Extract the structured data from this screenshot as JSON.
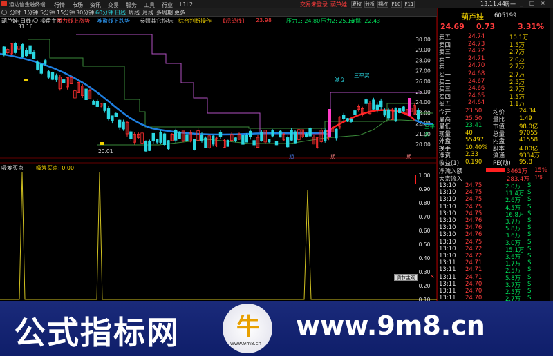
{
  "window": {
    "app_title": "通达信金融终端",
    "center_text_1": "交易未登录",
    "center_text_2": "葫芦娃",
    "time": "13:11:44",
    "weekday": "周一",
    "right_tabs": [
      "夏权",
      "分析",
      "期权",
      "F10",
      "F11"
    ],
    "window_controls": [
      "_",
      "□",
      "×"
    ]
  },
  "menu": {
    "items": [
      "行情",
      "市场",
      "资讯",
      "交易",
      "服务",
      "工具",
      "行业",
      "L1L2"
    ],
    "period_tabs": [
      "分时",
      "1分钟",
      "5分钟",
      "15分钟",
      "30分钟",
      "60分钟",
      "日线",
      "周线",
      "月线",
      "多周期",
      "更多"
    ]
  },
  "main_chart": {
    "stock_label": "葫芦娃(日线)",
    "indicator_label": "操盘主图",
    "legends": [
      {
        "text": "阻力线上涨势",
        "color": "#ff4040"
      },
      {
        "text": "唯盈线下跌势",
        "color": "#30a0ff"
      },
      {
        "text": "参照其它指标:",
        "color": "#cccccc"
      },
      {
        "text": "综合判断操作",
        "color": "#f0d000"
      },
      {
        "text": "【观望线】",
        "color": "#ff3c3c"
      },
      {
        "text": "23.98",
        "color": "#ff3c3c"
      },
      {
        "text": "压力1: 24.80",
        "color": "#00e05a"
      },
      {
        "text": "压力2: 25.13",
        "color": "#00e05a"
      },
      {
        "text": "支撑: 22.43",
        "color": "#00e05a"
      }
    ],
    "price_axis": [
      "30.00",
      "29.00",
      "28.00",
      "27.00",
      "26.00",
      "25.00",
      "24.00",
      "23.00",
      "22.00",
      "21.00",
      "20.00"
    ],
    "annotations": {
      "high_label": "31.16",
      "low_label": "20.01",
      "sell_label": "減仓",
      "three_buy_label": "三平买",
      "three_buy_right": "三平买",
      "bottom_marks": [
        "期",
        "期",
        "期"
      ]
    },
    "overlay_x_close": "×"
  },
  "sub_chart": {
    "title": "吸筹买点",
    "legend": "吸筹买点: 0.00",
    "axis": [
      "1.00",
      "0.90",
      "0.80",
      "0.70",
      "0.60",
      "0.50",
      "0.40",
      "0.30",
      "0.20",
      "0.10"
    ],
    "popup_label": "调节主观"
  },
  "quote_panel": {
    "stock_name": "葫芦娃",
    "stock_code": "605199",
    "price": "24.69",
    "change": "0.73",
    "change_pct": "3.31%",
    "asks": [
      {
        "label": "卖五",
        "price": "24.74",
        "volume": "10.1万"
      },
      {
        "label": "卖四",
        "price": "24.73",
        "volume": "1.5万"
      },
      {
        "label": "卖三",
        "price": "24.72",
        "volume": "2.7万"
      },
      {
        "label": "卖二",
        "price": "24.71",
        "volume": "2.0万"
      },
      {
        "label": "卖一",
        "price": "24.70",
        "volume": "2.7万"
      }
    ],
    "bids": [
      {
        "label": "买一",
        "price": "24.68",
        "volume": "2.7万"
      },
      {
        "label": "买二",
        "price": "24.67",
        "volume": "2.5万"
      },
      {
        "label": "买三",
        "price": "24.66",
        "volume": "2.7万"
      },
      {
        "label": "买四",
        "price": "24.65",
        "volume": "1.5万"
      },
      {
        "label": "买五",
        "price": "24.64",
        "volume": "1.1万"
      }
    ],
    "stats": [
      {
        "k1": "今开",
        "v1": "23.50",
        "k2": "均价",
        "v2": "24.34"
      },
      {
        "k1": "最高",
        "v1": "25.50",
        "k2": "量比",
        "v2": "1.49"
      },
      {
        "k1": "最低",
        "v1": "23.41",
        "k2": "市值",
        "v2": "98.0亿"
      },
      {
        "k1": "现量",
        "v1": "40",
        "k2": "总量",
        "v2": "97055"
      },
      {
        "k1": "外盘",
        "v1": "55497",
        "k2": "内盘",
        "v2": "41558"
      },
      {
        "k1": "换手",
        "v1": "10.40%",
        "k2": "股本",
        "v2": "4.00亿"
      },
      {
        "k1": "净资",
        "v1": "2.33",
        "k2": "流通",
        "v2": "9334万"
      },
      {
        "k1": "收益(1)",
        "v1": "0.190",
        "k2": "PE(动)",
        "v2": "95.8"
      }
    ],
    "flows": [
      {
        "label": "净流入额",
        "value": "3461万",
        "pct": "15%"
      },
      {
        "label": "大宗流入",
        "value": "283.4万",
        "pct": "1%"
      }
    ],
    "ticks": [
      {
        "t": "13:10",
        "p": "24.75",
        "v": "2.0万",
        "s": "S"
      },
      {
        "t": "13:10",
        "p": "24.75",
        "v": "11.4万",
        "s": "S"
      },
      {
        "t": "13:10",
        "p": "24.75",
        "v": "2.6万",
        "s": "S"
      },
      {
        "t": "13:10",
        "p": "24.75",
        "v": "4.5万",
        "s": "S"
      },
      {
        "t": "13:10",
        "p": "24.75",
        "v": "16.8万",
        "s": "S"
      },
      {
        "t": "13:10",
        "p": "24.76",
        "v": "3.7万",
        "s": "S"
      },
      {
        "t": "13:10",
        "p": "24.76",
        "v": "5.8万",
        "s": "S"
      },
      {
        "t": "13:10",
        "p": "24.76",
        "v": "3.6万",
        "s": "S"
      },
      {
        "t": "13:10",
        "p": "24.75",
        "v": "3.0万",
        "s": "S"
      },
      {
        "t": "13:10",
        "p": "24.72",
        "v": "15.1万",
        "s": "S"
      },
      {
        "t": "13:10",
        "p": "24.72",
        "v": "3.6万",
        "s": "S"
      },
      {
        "t": "13:11",
        "p": "24.71",
        "v": "1.7万",
        "s": "S"
      },
      {
        "t": "13:11",
        "p": "24.71",
        "v": "2.5万",
        "s": "S"
      },
      {
        "t": "13:11",
        "p": "24.71",
        "v": "5.8万",
        "s": "S"
      },
      {
        "t": "13:11",
        "p": "24.70",
        "v": "3.7万",
        "s": "S"
      },
      {
        "t": "13:11",
        "p": "24.70",
        "v": "2.5万",
        "s": "S"
      },
      {
        "t": "13:11",
        "p": "24.70",
        "v": "2.7万",
        "s": "S"
      }
    ]
  },
  "banner": {
    "left_text": "公式指标网",
    "right_text": "www.9m8.cn",
    "logo_text": "牛",
    "logo_sub": "www.9m8.cn"
  }
}
